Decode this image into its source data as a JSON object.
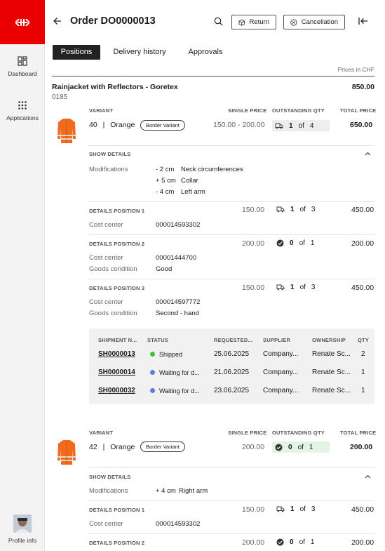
{
  "sidebar": {
    "items": [
      {
        "label": "Dashboard",
        "icon": "dashboard-icon"
      },
      {
        "label": "Applications",
        "icon": "grid-icon"
      }
    ],
    "profile_label": "Profile info",
    "brand_color": "#eb0000"
  },
  "header": {
    "title": "Order DO0000013",
    "return_label": "Return",
    "cancellation_label": "Cancellation"
  },
  "tabs": [
    {
      "label": "Positions",
      "active": true
    },
    {
      "label": "Delivery history",
      "active": false
    },
    {
      "label": "Approvals",
      "active": false
    }
  ],
  "prices_note": "Prices in CHF",
  "product": {
    "title": "Rainjacket with Reflectors - Goretex",
    "code": "0185",
    "total": "850.00"
  },
  "columns": {
    "variant": "VARIANT",
    "single_price": "SINGLE PRICE",
    "outstanding_qty": "OUTSTANDING QTY",
    "total_price": "TOTAL PRICE"
  },
  "variant1": {
    "size": "40",
    "separator": "|",
    "color": "Orange",
    "badge": "Border Variant",
    "single_price": "150.00 - 200.00",
    "qty_done": "1",
    "qty_of": "of",
    "qty_total": "4",
    "total_price": "650.00",
    "show_details": "SHOW DETAILS",
    "modifications_label": "Modifications",
    "modifications": [
      {
        "amount": "- 2 cm",
        "part": "Neck circumferences"
      },
      {
        "amount": "+ 5 cm",
        "part": "Collar"
      },
      {
        "amount": "- 4 cm",
        "part": "Left arm"
      }
    ],
    "positions": [
      {
        "label": "DETAILS POSITION 1",
        "price": "150.00",
        "icon": "truck-icon",
        "qty_done": "1",
        "qty_of": "of",
        "qty_total": "3",
        "total": "450.00",
        "fields": [
          {
            "label": "Cost center",
            "value": "000014593302"
          }
        ]
      },
      {
        "label": "DETAILS POSITION 2",
        "price": "200.00",
        "icon": "check-circle-icon",
        "qty_done": "0",
        "qty_of": "of",
        "qty_total": "1",
        "total": "200.00",
        "fields": [
          {
            "label": "Cost center",
            "value": "00001444700"
          },
          {
            "label": "Goods condition",
            "value": "Good"
          }
        ]
      },
      {
        "label": "DETAILS POSITION 3",
        "price": "150.00",
        "icon": "truck-icon",
        "qty_done": "1",
        "qty_of": "of",
        "qty_total": "3",
        "total": "450.00",
        "fields": [
          {
            "label": "Cost center",
            "value": "000014597772"
          },
          {
            "label": "Goods condition",
            "value": "Second - hand"
          }
        ]
      }
    ]
  },
  "shipments": {
    "headers": [
      "SHIPMENT N...",
      "STATUS",
      "REQUESTED...",
      "SUPPLIER",
      "OWNERSHIP",
      "QTY"
    ],
    "rows": [
      {
        "id": "SH0000013",
        "status": "Shipped",
        "status_color": "#3cc13b",
        "requested": "25.06.2025",
        "supplier": "Company...",
        "owner": "Renate Sc...",
        "qty": "2"
      },
      {
        "id": "SH0000014",
        "status": "Waiting for d...",
        "status_color": "#5b7fe0",
        "requested": "21.06.2025",
        "supplier": "Company...",
        "owner": "Renate Sc...",
        "qty": "1"
      },
      {
        "id": "SH0000032",
        "status": "Waiting for d...",
        "status_color": "#5b7fe0",
        "requested": "23.06.2025",
        "supplier": "Company...",
        "owner": "Renate Sc...",
        "qty": "1"
      }
    ]
  },
  "variant2": {
    "size": "42",
    "separator": "|",
    "color": "Orange",
    "badge": "Border Variant",
    "single_price": "200.00",
    "qty_done": "0",
    "qty_of": "of",
    "qty_total": "1",
    "total_price": "200.00",
    "show_details": "SHOW DETAILS",
    "modifications_label": "Modifications",
    "modifications": [
      {
        "amount": "+ 4 cm",
        "part": "Right arm"
      }
    ],
    "positions": [
      {
        "label": "DETAILS POSITION 1",
        "price": "150.00",
        "icon": "truck-icon",
        "qty_done": "1",
        "qty_of": "of",
        "qty_total": "3",
        "total": "450.00",
        "fields": [
          {
            "label": "Cost center",
            "value": "000014593302"
          }
        ]
      },
      {
        "label": "DETAILS POSITION 2",
        "price": "200.00",
        "icon": "check-circle-icon",
        "qty_done": "0",
        "qty_of": "of",
        "qty_total": "1",
        "total": "200.00",
        "fields": []
      }
    ]
  }
}
